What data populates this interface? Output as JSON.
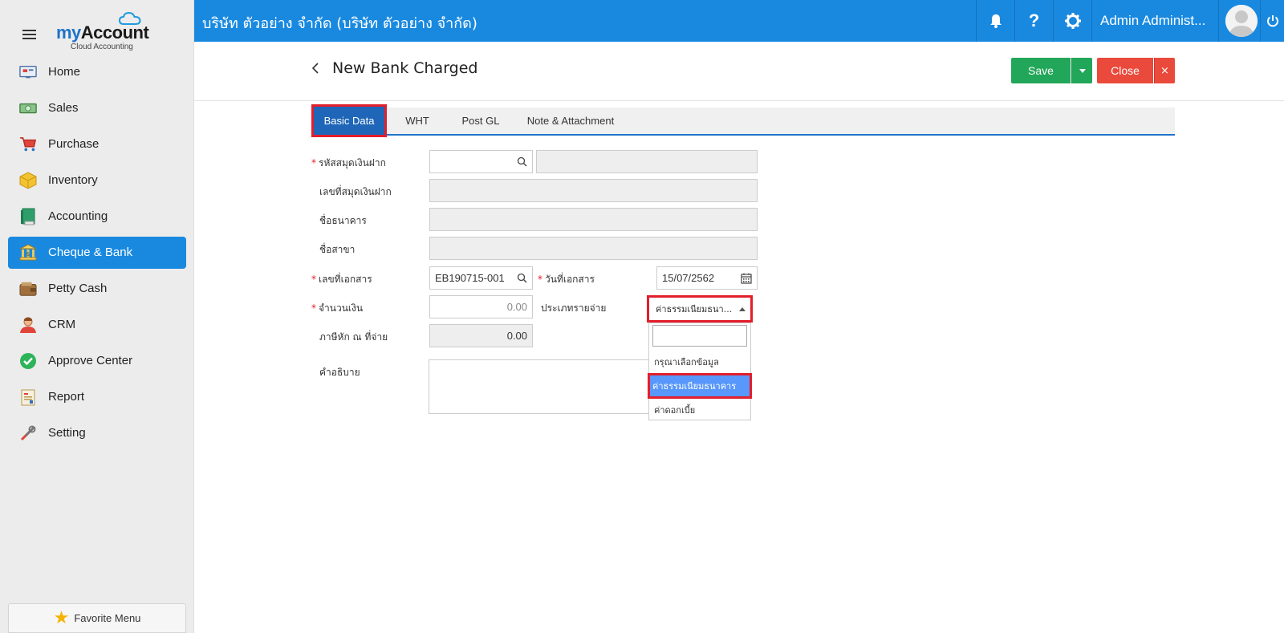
{
  "app": {
    "logo_my": "my",
    "logo_account": "Account",
    "logo_sub": "Cloud Accounting"
  },
  "sidebar": {
    "items": [
      {
        "label": "Home",
        "icon": "home-icon"
      },
      {
        "label": "Sales",
        "icon": "cash-icon"
      },
      {
        "label": "Purchase",
        "icon": "cart-icon"
      },
      {
        "label": "Inventory",
        "icon": "box-icon"
      },
      {
        "label": "Accounting",
        "icon": "book-icon"
      },
      {
        "label": "Cheque & Bank",
        "icon": "bank-icon"
      },
      {
        "label": "Petty Cash",
        "icon": "wallet-icon"
      },
      {
        "label": "CRM",
        "icon": "person-icon"
      },
      {
        "label": "Approve Center",
        "icon": "check-circle-icon"
      },
      {
        "label": "Report",
        "icon": "report-icon"
      },
      {
        "label": "Setting",
        "icon": "tools-icon"
      }
    ],
    "active_index": 5,
    "favorite_label": "Favorite Menu"
  },
  "header": {
    "company": "บริษัท ตัวอย่าง จำกัด (บริษัท ตัวอย่าง จำกัด)",
    "username": "Admin Administ...",
    "colors": {
      "primary": "#1989e0",
      "save": "#22a659",
      "close": "#ea4a3c",
      "highlight": "#e41e2b"
    }
  },
  "page": {
    "title": "New Bank Charged",
    "save_label": "Save",
    "close_label": "Close",
    "close_x": "×"
  },
  "tabs": [
    {
      "label": "Basic Data",
      "active": true
    },
    {
      "label": "WHT",
      "active": false
    },
    {
      "label": "Post GL",
      "active": false
    },
    {
      "label": "Note & Attachment",
      "active": false
    }
  ],
  "form": {
    "passbook_code_label": "รหัสสมุดเงินฝาก",
    "passbook_no_label": "เลขที่สมุดเงินฝาก",
    "bank_name_label": "ชื่อธนาคาร",
    "branch_label": "ชื่อสาขา",
    "doc_no_label": "เลขที่เอกสาร",
    "doc_no_value": "EB190715-001",
    "doc_date_label": "วันที่เอกสาร",
    "doc_date_value": "15/07/2562",
    "amount_label": "จำนวนเงิน",
    "amount_value": "0.00",
    "expense_type_label": "ประเภทรายจ่าย",
    "expense_type_value": "ค่าธรรมเนียมธนา...",
    "wht_label": "ภาษีหัก ณ ที่จ่าย",
    "wht_value": "0.00",
    "description_label": "คำอธิบาย"
  },
  "dropdown": {
    "options": [
      "กรุณาเลือกข้อมูล",
      "ค่าธรรมเนียมธนาคาร",
      "ค่าดอกเบี้ย"
    ],
    "selected_index": 1
  }
}
